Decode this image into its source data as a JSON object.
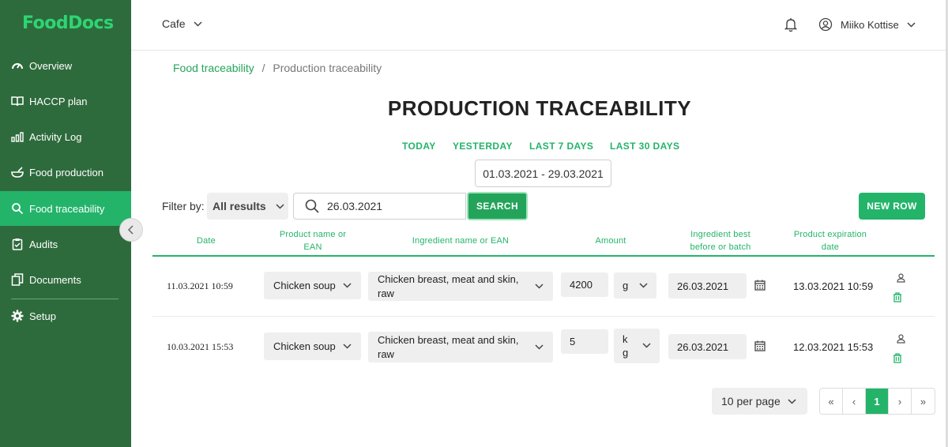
{
  "app": {
    "logo": "FoodDocs"
  },
  "sidebar": {
    "items": [
      {
        "label": "Overview",
        "icon": "gauge-icon"
      },
      {
        "label": "HACCP plan",
        "icon": "book-icon"
      },
      {
        "label": "Activity Log",
        "icon": "bar-chart-icon"
      },
      {
        "label": "Food production",
        "icon": "bowl-icon"
      },
      {
        "label": "Food traceability",
        "icon": "search-icon",
        "active": true
      },
      {
        "label": "Audits",
        "icon": "clipboard-icon"
      },
      {
        "label": "Documents",
        "icon": "documents-icon"
      },
      {
        "label": "Setup",
        "icon": "gear-icon"
      }
    ]
  },
  "header": {
    "location": "Cafe",
    "user_name": "Miiko Kottise"
  },
  "breadcrumb": {
    "parent": "Food traceability",
    "separator": "/",
    "current": "Production traceability"
  },
  "page": {
    "title": "PRODUCTION TRACEABILITY"
  },
  "quick_ranges": [
    "TODAY",
    "YESTERDAY",
    "LAST 7 DAYS",
    "LAST 30 DAYS"
  ],
  "date_range": "01.03.2021 - 29.03.2021",
  "filter": {
    "label": "Filter by:",
    "selected": "All results",
    "search_value": "26.03.2021",
    "search_button": "SEARCH"
  },
  "new_row_button": "NEW ROW",
  "table": {
    "headers": {
      "date": "Date",
      "product_l1": "Product name or",
      "product_l2": "EAN",
      "ingredient": "Ingredient name or EAN",
      "amount": "Amount",
      "best_l1": "Ingredient best",
      "best_l2": "before or batch",
      "exp_l1": "Product expiration",
      "exp_l2": "date"
    },
    "rows": [
      {
        "date": "11.03.2021  10:59",
        "product": "Chicken soup",
        "ingredient_l1": "Chicken breast, meat and skin,",
        "ingredient_l2": "raw",
        "amount": "4200",
        "unit": "g",
        "best_before": "26.03.2021",
        "expiration": "13.03.2021 10:59"
      },
      {
        "date": "10.03.2021  15:53",
        "product": "Chicken soup",
        "ingredient_l1": "Chicken breast, meat and skin,",
        "ingredient_l2": "raw",
        "amount": "5",
        "unit_l1": "k",
        "unit_l2": "g",
        "best_before": "26.03.2021",
        "expiration": "12.03.2021 15:53"
      }
    ]
  },
  "pagination": {
    "per_page": "10 per page",
    "first": "«",
    "prev": "‹",
    "current": "1",
    "next": "›",
    "last": "»"
  },
  "colors": {
    "sidebar": "#2e6b3c",
    "accent": "#23b46a",
    "logo": "#2ed573"
  }
}
